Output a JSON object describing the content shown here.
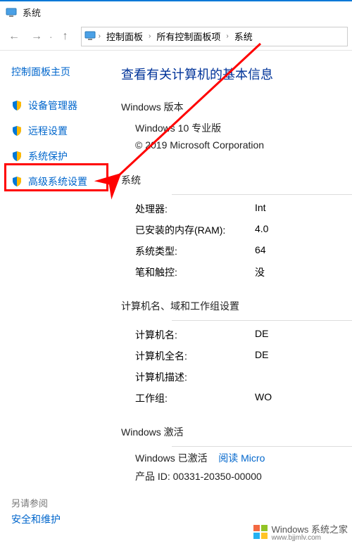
{
  "window": {
    "title": "系统"
  },
  "breadcrumb": {
    "items": [
      "控制面板",
      "所有控制面板项",
      "系统"
    ]
  },
  "sidebar": {
    "home": "控制面板主页",
    "items": [
      {
        "label": "设备管理器"
      },
      {
        "label": "远程设置"
      },
      {
        "label": "系统保护"
      },
      {
        "label": "高级系统设置"
      }
    ],
    "see_also_heading": "另请参阅",
    "see_also_link": "安全和维护"
  },
  "main": {
    "heading": "查看有关计算机的基本信息",
    "win_edition_section": "Windows 版本",
    "win_edition_value": "Windows 10 专业版",
    "copyright": "© 2019 Microsoft Corporation",
    "system_section": "系统",
    "rows_system": [
      {
        "k": "处理器:",
        "v": "Int"
      },
      {
        "k": "已安装的内存(RAM):",
        "v": "4.0"
      },
      {
        "k": "系统类型:",
        "v": "64"
      },
      {
        "k": "笔和触控:",
        "v": "没"
      }
    ],
    "cnd_section": "计算机名、域和工作组设置",
    "rows_cnd": [
      {
        "k": "计算机名:",
        "v": "DE"
      },
      {
        "k": "计算机全名:",
        "v": "DE"
      },
      {
        "k": "计算机描述:",
        "v": ""
      },
      {
        "k": "工作组:",
        "v": "WO"
      }
    ],
    "activation_section": "Windows 激活",
    "activation_status": "Windows 已激活",
    "activation_link": "阅读 Micro",
    "product_id_label": "产品 ID:",
    "product_id_value": "00331-20350-00000"
  },
  "watermark": {
    "brand": "Windows",
    "sub": "系统之家",
    "url": "www.bjjmlv.com"
  }
}
